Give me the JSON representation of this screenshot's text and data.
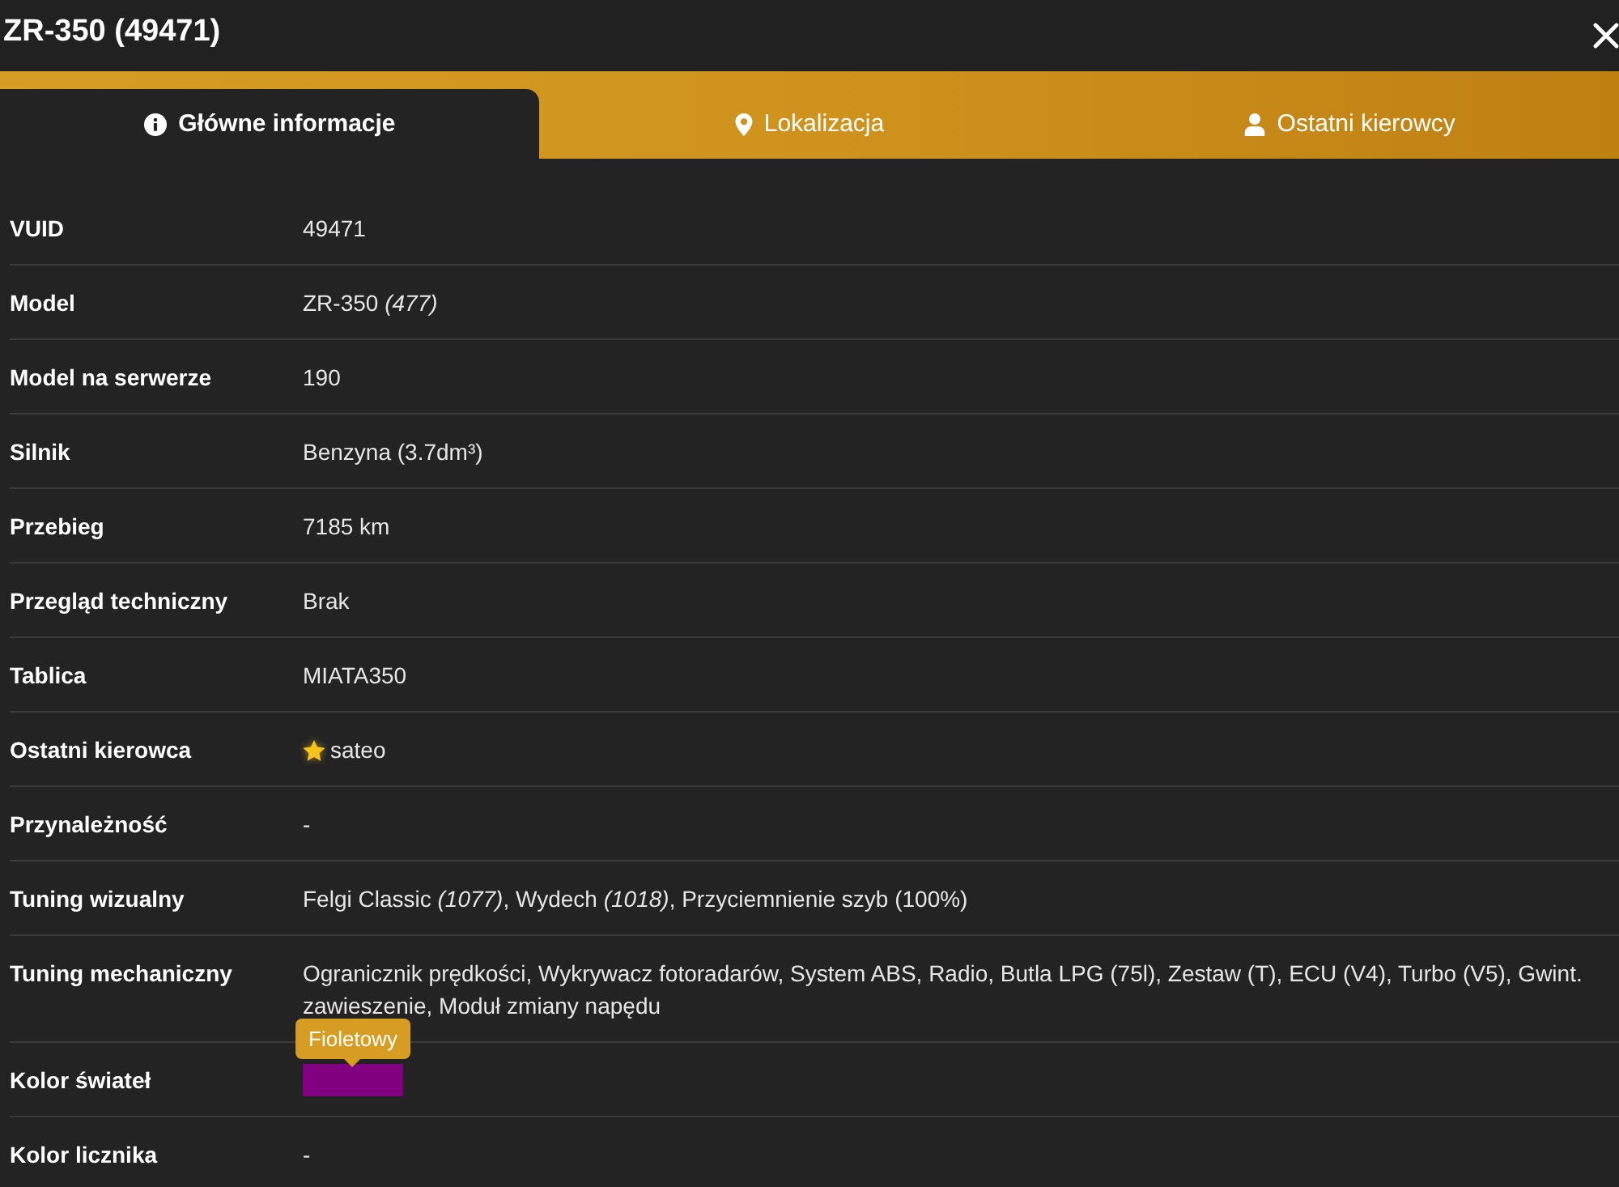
{
  "window": {
    "title": "ZR-350 (49471)"
  },
  "tabs": [
    {
      "label": "Główne informacje",
      "kind": "info",
      "selected": true
    },
    {
      "label": "Lokalizacja",
      "kind": "location",
      "selected": false
    },
    {
      "label": "Ostatni kierowcy",
      "kind": "drivers",
      "selected": false
    }
  ],
  "rows": [
    {
      "label": "VUID",
      "kind": "text",
      "value": "49471",
      "starred": false
    },
    {
      "label": "Model",
      "kind": "text",
      "value": "ZR-350 *(477)*",
      "starred": false
    },
    {
      "label": "Model na serwerze",
      "kind": "text",
      "value": "190",
      "starred": false
    },
    {
      "label": "Silnik",
      "kind": "text",
      "value": "Benzyna (3.7dm³)",
      "starred": false
    },
    {
      "label": "Przebieg",
      "kind": "text",
      "value": "7185 km",
      "starred": false
    },
    {
      "label": "Przegląd techniczny",
      "kind": "text",
      "value": "Brak",
      "starred": false
    },
    {
      "label": "Tablica",
      "kind": "text",
      "value": "MIATA350",
      "starred": false
    },
    {
      "label": "Ostatni kierowca",
      "kind": "text",
      "value": "sateo",
      "starred": true
    },
    {
      "label": "Przynależność",
      "kind": "text",
      "value": "-",
      "starred": false
    },
    {
      "label": "Tuning wizualny",
      "kind": "text",
      "value": "Felgi Classic *(1077)*, Wydech *(1018)*, Przyciemnienie szyb (100%)",
      "starred": false
    },
    {
      "label": "Tuning mechaniczny",
      "kind": "text",
      "value": "Ogranicznik prędkości, Wykrywacz fotoradarów, System ABS, Radio, Butla LPG (75l), Zestaw (T), ECU (V4), Turbo (V5), Gwint. zawieszenie, Moduł zmiany napędu",
      "starred": false
    },
    {
      "label": "Kolor świateł",
      "kind": "color",
      "color": "#800080",
      "tooltip": "Fioletowy"
    },
    {
      "label": "Kolor licznika",
      "kind": "text",
      "value": "-",
      "starred": false
    }
  ]
}
